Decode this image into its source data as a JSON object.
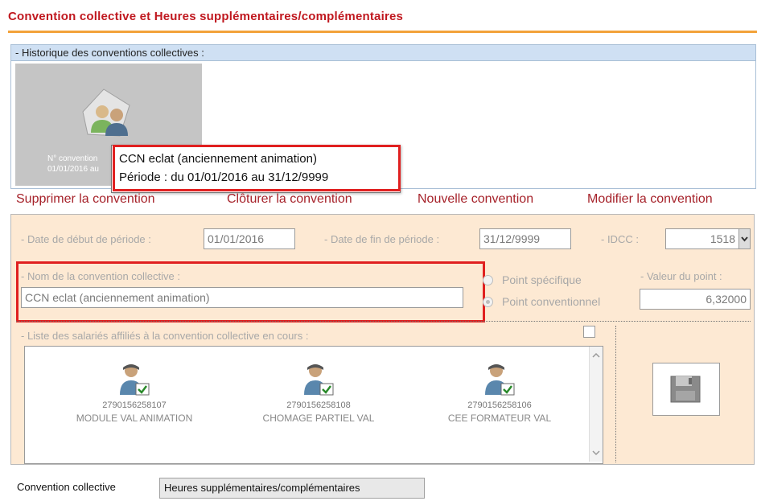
{
  "header": {
    "title": "Convention collective et Heures supplémentaires/complémentaires"
  },
  "history": {
    "heading": "- Historique des conventions collectives :",
    "tile_line1": "N° convention",
    "tile_line2": "01/01/2016 au",
    "tooltip_line1": "CCN eclat (anciennement animation)",
    "tooltip_line2": "Période : du 01/01/2016 au 31/12/9999"
  },
  "actions": {
    "delete": "Supprimer la convention",
    "close": "Clôturer la convention",
    "new": "Nouvelle convention",
    "modify": "Modifier la convention"
  },
  "form": {
    "start_label": "- Date de début de période :",
    "start_value": "01/01/2016",
    "end_label": "- Date de fin de période :",
    "end_value": "31/12/9999",
    "idcc_label": "- IDCC :",
    "idcc_value": "1518",
    "name_label": "- Nom de la convention collective :",
    "name_value": "CCN eclat (anciennement animation)",
    "radio_specific": "Point spécifique",
    "radio_conventional": "Point conventionnel",
    "point_label": "- Valeur du point :",
    "point_value": "6,32000",
    "employees_label": "- Liste des salariés affiliés à la convention collective en cours :"
  },
  "employees": [
    {
      "number": "2790156258107",
      "name": "MODULE VAL ANIMATION"
    },
    {
      "number": "2790156258108",
      "name": "CHOMAGE PARTIEL VAL"
    },
    {
      "number": "2790156258106",
      "name": "CEE FORMATEUR VAL"
    }
  ],
  "tabs": {
    "tab1": "Convention collective",
    "tab2": "Heures supplémentaires/complémentaires"
  },
  "colors": {
    "title": "#c0181f",
    "accent_line": "#f2a23a",
    "panel": "#fde9d3",
    "highlight": "#e02020"
  }
}
